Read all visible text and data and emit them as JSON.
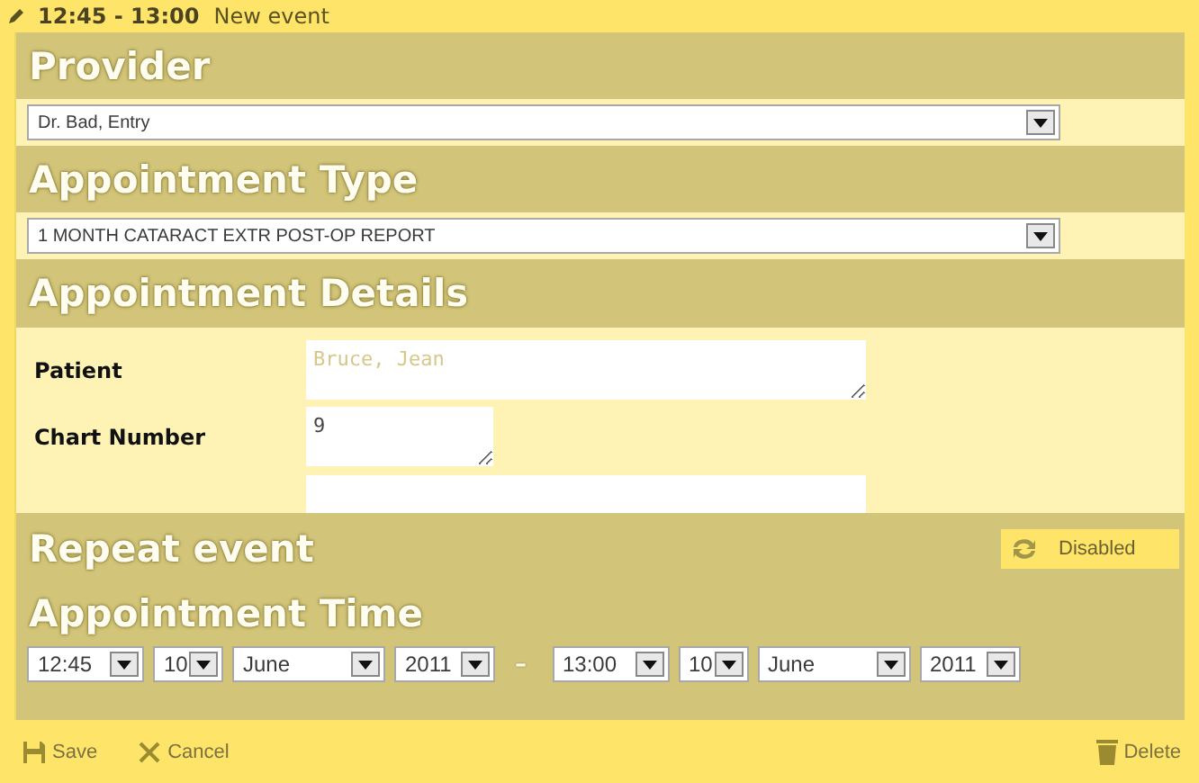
{
  "title_bar": {
    "time": "12:45 - 13:00",
    "label": "New event"
  },
  "provider": {
    "heading": "Provider",
    "value": "Dr. Bad, Entry"
  },
  "appointment_type": {
    "heading": "Appointment Type",
    "value": "1 MONTH CATARACT EXTR POST-OP REPORT"
  },
  "details": {
    "heading": "Appointment Details",
    "fields": [
      {
        "label": "Patient",
        "placeholder": "Bruce, Jean",
        "kind": "textarea"
      },
      {
        "label": "Chart Number",
        "value": "9",
        "kind": "short"
      },
      {
        "kind": "input"
      }
    ]
  },
  "repeat": {
    "heading": "Repeat event",
    "status": "Disabled",
    "on": false
  },
  "time": {
    "heading": "Appointment Time",
    "separator": "–",
    "start": [
      {
        "value": "12:45",
        "kind": "time"
      },
      {
        "value": "10",
        "kind": "day"
      },
      {
        "value": "June",
        "kind": "month"
      },
      {
        "value": "2011",
        "kind": "year"
      }
    ],
    "end": [
      {
        "value": "13:00",
        "kind": "time"
      },
      {
        "value": "10",
        "kind": "day"
      },
      {
        "value": "June",
        "kind": "month"
      },
      {
        "value": "2011",
        "kind": "year"
      }
    ]
  },
  "footer": {
    "save": "Save",
    "cancel": "Cancel",
    "delete": "Delete"
  }
}
